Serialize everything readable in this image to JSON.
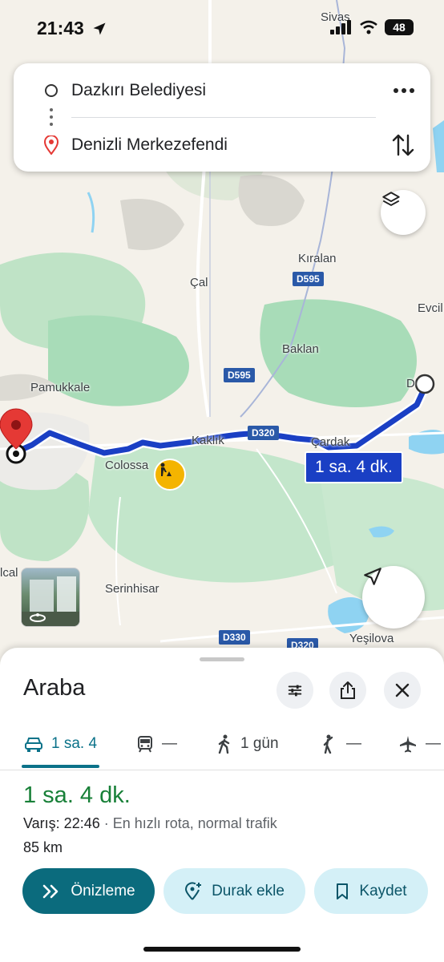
{
  "status_bar": {
    "time": "21:43",
    "battery": "48",
    "top_label": "Sivas"
  },
  "search": {
    "origin": "Dazkırı Belediyesi",
    "destination": "Denizli Merkezefendi",
    "more_icon": "more-horizontal-icon",
    "swap_icon": "swap-vertical-icon"
  },
  "map": {
    "places": {
      "kiralan": "Kıralan",
      "cal": "Çal",
      "evcil": "Evcil",
      "baklan": "Baklan",
      "pamukkale": "Pamukkale",
      "kaklik": "Kaklık",
      "cardak": "Çardak",
      "colossae": "Colossa",
      "serinhisar": "Serinhisar",
      "yesilova": "Yeşilova",
      "dazkiri_partial": "D",
      "left_partial": "lcal"
    },
    "shields": {
      "d595_top": "D595",
      "d595_mid": "D595",
      "d320": "D320",
      "d330": "D330",
      "d320_bottom": "D320"
    },
    "time_badge": "1 sa. 4 dk.",
    "colors": {
      "route": "#1a3fc4",
      "water": "#8fd3f2",
      "park": "#a8dcb8",
      "land": "#f4f1ea"
    }
  },
  "sheet": {
    "title": "Araba",
    "modes": [
      {
        "label": "1 sa. 4",
        "icon": "car-icon"
      },
      {
        "label": "—",
        "icon": "train-icon"
      },
      {
        "label": "1 gün",
        "icon": "walk-icon"
      },
      {
        "label": "—",
        "icon": "ride-hail-icon"
      },
      {
        "label": "—",
        "icon": "flight-icon"
      }
    ],
    "duration": "1 sa. 4 dk.",
    "arrival_label": "Varış: 22:46",
    "route_note": " · En hızlı rota, normal trafik",
    "distance": "85 km",
    "buttons": {
      "preview": "Önizleme",
      "add_stop": "Durak ekle",
      "save": "Kaydet"
    },
    "accent": "#0b6b7d"
  }
}
